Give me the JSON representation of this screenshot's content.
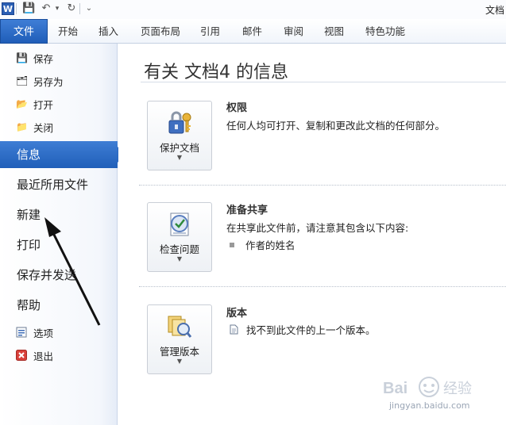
{
  "titlebar": {
    "app_icon": "word-icon",
    "app_icon_letter": "W",
    "quick_access": [
      {
        "name": "save-icon",
        "glyph": "💾"
      },
      {
        "name": "undo-icon",
        "glyph": "↶"
      },
      {
        "name": "redo-icon",
        "glyph": "↻"
      },
      {
        "name": "customize-quick-access-icon",
        "glyph": "⌄"
      }
    ],
    "title": "文档"
  },
  "ribbon": {
    "file_tab": "文件",
    "tabs": [
      "开始",
      "插入",
      "页面布局",
      "引用",
      "邮件",
      "审阅",
      "视图",
      "特色功能"
    ]
  },
  "nav": {
    "small_items": [
      {
        "label": "保存",
        "icon": "save-icon",
        "glyph": "💾"
      },
      {
        "label": "另存为",
        "icon": "save-as-icon",
        "glyph": "🗂"
      },
      {
        "label": "打开",
        "icon": "open-folder-icon",
        "glyph": "📂"
      },
      {
        "label": "关闭",
        "icon": "close-folder-icon",
        "glyph": "📁"
      }
    ],
    "big_items": [
      "信息",
      "最近所用文件",
      "新建",
      "打印",
      "保存并发送",
      "帮助"
    ],
    "active_item": "信息",
    "bottom_items": [
      {
        "label": "选项",
        "icon": "options-icon"
      },
      {
        "label": "退出",
        "icon": "exit-icon"
      }
    ]
  },
  "main": {
    "title": "有关 文档4 的信息",
    "sections": [
      {
        "button_label": "保护文档",
        "icon": "lock-keys-icon",
        "heading": "权限",
        "description": "任何人均可打开、复制和更改此文档的任何部分。"
      },
      {
        "button_label": "检查问题",
        "icon": "checklist-icon",
        "heading": "准备共享",
        "description": "在共享此文件前，请注意其包含以下内容:",
        "bullet": "作者的姓名"
      },
      {
        "button_label": "管理版本",
        "icon": "document-versions-icon",
        "heading": "版本",
        "bullet": "找不到此文件的上一个版本。"
      }
    ]
  },
  "watermark": {
    "text": "jingyan.baidu.com",
    "logo_text": "Bai 经验"
  },
  "colors": {
    "accent": "#2a68c1",
    "file_tab": "#2b63bd"
  }
}
